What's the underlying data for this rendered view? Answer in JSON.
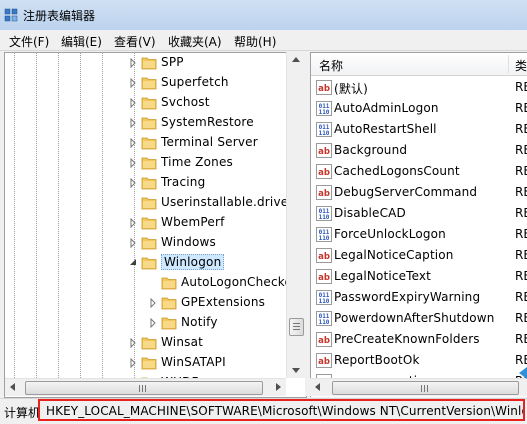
{
  "window": {
    "title": "注册表编辑器"
  },
  "menu": [
    {
      "label": "文件(F)"
    },
    {
      "label": "编辑(E)"
    },
    {
      "label": "查看(V)"
    },
    {
      "label": "收藏夹(A)"
    },
    {
      "label": "帮助(H)"
    }
  ],
  "tree": {
    "items": [
      {
        "label": "SPP",
        "level": 1,
        "expandable": true,
        "expanded": false
      },
      {
        "label": "Superfetch",
        "level": 1,
        "expandable": true,
        "expanded": false
      },
      {
        "label": "Svchost",
        "level": 1,
        "expandable": true,
        "expanded": false
      },
      {
        "label": "SystemRestore",
        "level": 1,
        "expandable": true,
        "expanded": false
      },
      {
        "label": "Terminal Server",
        "level": 1,
        "expandable": true,
        "expanded": false
      },
      {
        "label": "Time Zones",
        "level": 1,
        "expandable": true,
        "expanded": false
      },
      {
        "label": "Tracing",
        "level": 1,
        "expandable": true,
        "expanded": false
      },
      {
        "label": "Userinstallable.drivers",
        "level": 1,
        "expandable": false,
        "expanded": false
      },
      {
        "label": "WbemPerf",
        "level": 1,
        "expandable": true,
        "expanded": false
      },
      {
        "label": "Windows",
        "level": 1,
        "expandable": true,
        "expanded": false
      },
      {
        "label": "Winlogon",
        "level": 1,
        "expandable": true,
        "expanded": true,
        "selected": true
      },
      {
        "label": "AutoLogonChecke",
        "level": 2,
        "expandable": false,
        "expanded": false
      },
      {
        "label": "GPExtensions",
        "level": 2,
        "expandable": true,
        "expanded": false
      },
      {
        "label": "Notify",
        "level": 2,
        "expandable": true,
        "expanded": false
      },
      {
        "label": "Winsat",
        "level": 1,
        "expandable": true,
        "expanded": false
      },
      {
        "label": "WinSATAPI",
        "level": 1,
        "expandable": true,
        "expanded": false
      },
      {
        "label": "WUDF",
        "level": 1,
        "expandable": true,
        "expanded": false
      }
    ]
  },
  "list": {
    "columns": {
      "name": "名称",
      "type": "类"
    },
    "rows": [
      {
        "icon": "string-value-icon",
        "name": "(默认)",
        "type": "RE"
      },
      {
        "icon": "binary-value-icon",
        "name": "AutoAdminLogon",
        "type": "RE"
      },
      {
        "icon": "binary-value-icon",
        "name": "AutoRestartShell",
        "type": "RE"
      },
      {
        "icon": "string-value-icon",
        "name": "Background",
        "type": "RE"
      },
      {
        "icon": "string-value-icon",
        "name": "CachedLogonsCount",
        "type": "RE"
      },
      {
        "icon": "string-value-icon",
        "name": "DebugServerCommand",
        "type": "RE"
      },
      {
        "icon": "binary-value-icon",
        "name": "DisableCAD",
        "type": "RE"
      },
      {
        "icon": "binary-value-icon",
        "name": "ForceUnlockLogon",
        "type": "RE"
      },
      {
        "icon": "string-value-icon",
        "name": "LegalNoticeCaption",
        "type": "RE"
      },
      {
        "icon": "string-value-icon",
        "name": "LegalNoticeText",
        "type": "RE"
      },
      {
        "icon": "binary-value-icon",
        "name": "PasswordExpiryWarning",
        "type": "RE"
      },
      {
        "icon": "binary-value-icon",
        "name": "PowerdownAfterShutdown",
        "type": "RE"
      },
      {
        "icon": "string-value-icon",
        "name": "PreCreateKnownFolders",
        "type": "RE"
      },
      {
        "icon": "string-value-icon",
        "name": "ReportBootOk",
        "type": "RE"
      },
      {
        "icon": "string-value-icon",
        "name": "scremoveoption",
        "type": "RE"
      }
    ]
  },
  "status": {
    "prefix": "计算机",
    "path": "HKEY_LOCAL_MACHINE\\SOFTWARE\\Microsoft\\Windows NT\\CurrentVersion\\Winlogon"
  },
  "colors": {
    "highlight_border": "#e8231f",
    "selection": "#cde8ff",
    "folder": "#f2c65a"
  }
}
